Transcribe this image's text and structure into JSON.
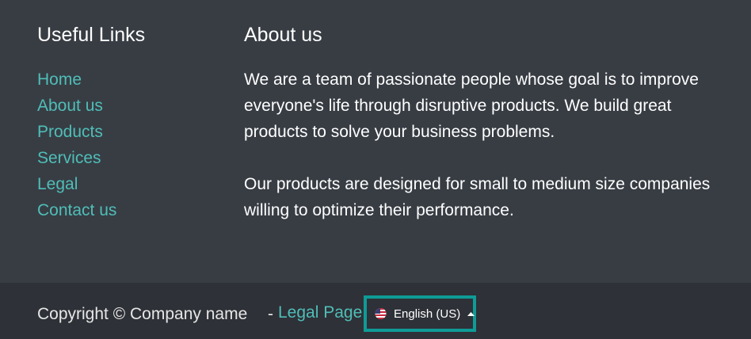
{
  "useful_links": {
    "heading": "Useful Links",
    "items": [
      "Home",
      "About us",
      "Products",
      "Services",
      "Legal",
      "Contact us"
    ]
  },
  "about": {
    "heading": "About us",
    "paragraphs": [
      "We are a team of passionate people whose goal is to improve everyone's life through disruptive products. We build great products to solve your business problems.",
      "Our products are designed for small to medium size companies willing to optimize their performance."
    ]
  },
  "bottom_bar": {
    "copyright": "Copyright © Company name",
    "separator": "-",
    "legal_page": "Legal Page",
    "language": {
      "label": "English (US)",
      "flag_icon": "us-flag-icon",
      "caret_icon": "caret-up-icon"
    }
  },
  "colors": {
    "footer_background": "#383d44",
    "bottom_bar_background": "#2e3137",
    "link": "#4fbeb8",
    "highlight_border": "#0f9b96"
  }
}
